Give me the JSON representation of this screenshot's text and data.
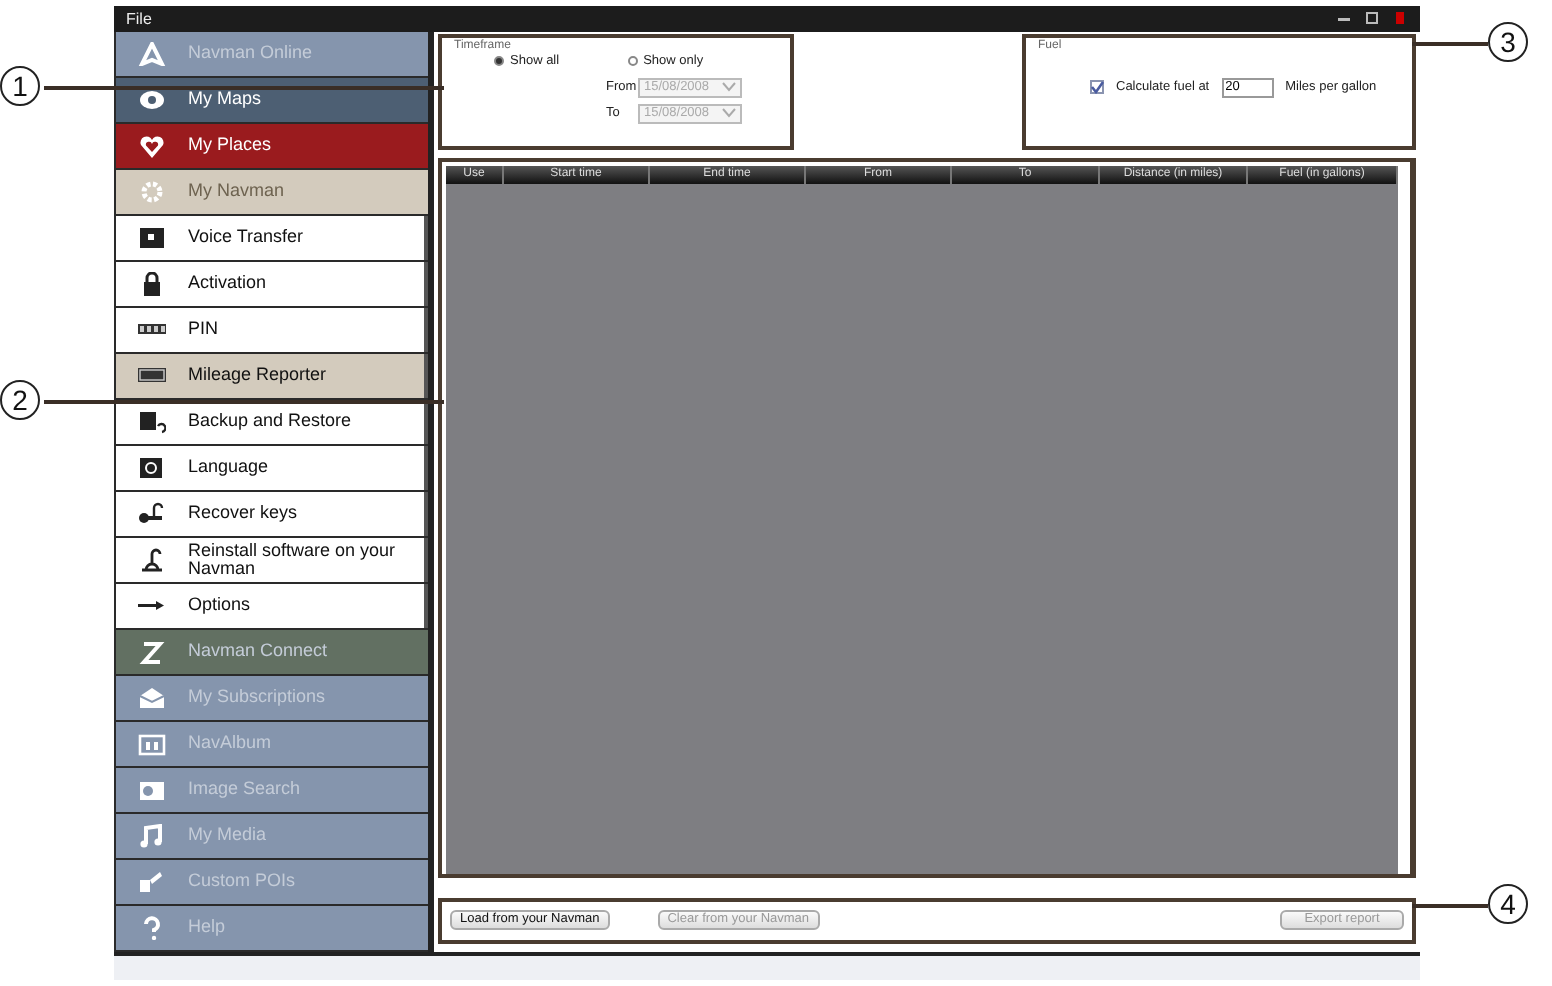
{
  "window": {
    "menu": [
      "File"
    ]
  },
  "sidebar": {
    "items": [
      {
        "kind": "section",
        "label": "Navman Online",
        "color": "#8595ad",
        "disabled": true
      },
      {
        "kind": "section",
        "label": "My Maps",
        "color": "#4d5f73",
        "disabled": false
      },
      {
        "kind": "section",
        "label": "My Places",
        "color": "#9a1b1e",
        "disabled": false
      },
      {
        "kind": "section",
        "label": "My Navman",
        "color": "#d3cbbd",
        "disabled": true
      },
      {
        "kind": "subitem",
        "label": "Voice Transfer",
        "selected": false
      },
      {
        "kind": "subitem",
        "label": "Activation",
        "selected": false
      },
      {
        "kind": "subitem",
        "label": "PIN",
        "selected": false
      },
      {
        "kind": "subitem",
        "label": "Mileage Reporter",
        "selected": true
      },
      {
        "kind": "subitem",
        "label": "Backup and Restore",
        "selected": false
      },
      {
        "kind": "subitem",
        "label": "Language",
        "selected": false
      },
      {
        "kind": "subitem",
        "label": "Recover keys",
        "selected": false
      },
      {
        "kind": "subitem",
        "label": "Reinstall software on your Navman",
        "selected": false
      },
      {
        "kind": "subitem",
        "label": "Options",
        "selected": false
      },
      {
        "kind": "section",
        "label": "Navman Connect",
        "color": "#627062",
        "disabled": true
      },
      {
        "kind": "section",
        "label": "My Subscriptions",
        "color": "#8595ad",
        "disabled": true
      },
      {
        "kind": "section",
        "label": "NavAlbum",
        "color": "#8595ad",
        "disabled": true
      },
      {
        "kind": "section",
        "label": "Image Search",
        "color": "#8595ad",
        "disabled": true
      },
      {
        "kind": "section",
        "label": "My Media",
        "color": "#8595ad",
        "disabled": true
      },
      {
        "kind": "section",
        "label": "Custom POIs",
        "color": "#8595ad",
        "disabled": true
      },
      {
        "kind": "section",
        "label": "Help",
        "color": "#8595ad",
        "disabled": true
      }
    ]
  },
  "timeframe": {
    "title": "Timeframe",
    "options": [
      {
        "label": "Show all",
        "selected": true
      },
      {
        "label": "Show only",
        "selected": false
      }
    ],
    "from": {
      "label": "From",
      "value": "15/08/2008",
      "disabled": true
    },
    "to": {
      "label": "To",
      "value": "15/08/2008",
      "disabled": true
    }
  },
  "fuel": {
    "title": "Fuel",
    "checkbox": {
      "label": "Calculate fuel at",
      "checked": true
    },
    "value": "20",
    "unit": "Miles per gallon"
  },
  "table": {
    "columns": [
      "Use",
      "Start time",
      "End time",
      "From",
      "To",
      "Distance (in miles)",
      "Fuel (in gallons)"
    ]
  },
  "buttons": [
    {
      "label": "Load from your Navman",
      "disabled": false
    },
    {
      "label": "Clear from your Navman",
      "disabled": true
    },
    {
      "label": "Export report",
      "disabled": true
    }
  ],
  "callouts": [
    "1",
    "2",
    "3",
    "4"
  ]
}
